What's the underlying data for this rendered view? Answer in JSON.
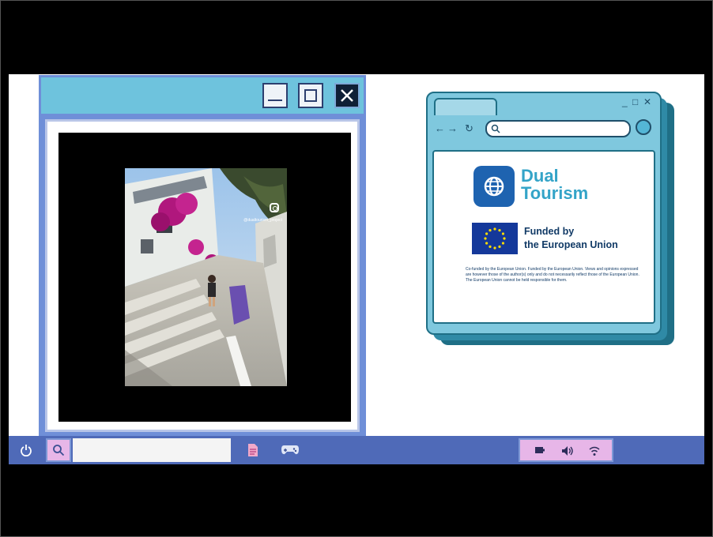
{
  "left_window": {
    "buttons": {
      "minimize": "minimize-button",
      "maximize": "maximize-button",
      "close": "close-button"
    },
    "photo": {
      "overlay_handle": "@dualtourism_project"
    }
  },
  "browser_window": {
    "controls": {
      "minimize": "_",
      "maximize": "□",
      "close": "✕"
    },
    "nav": {
      "back": "←",
      "forward": "→",
      "reload": "↻"
    },
    "address_bar": {
      "value": ""
    },
    "brand": {
      "line1": "Dual",
      "line2": "Tourism"
    },
    "eu": {
      "line1": "Funded by",
      "line2": "the European Union"
    },
    "disclaimer": "Co-funded by the European Union. Funded by the European Union. Views and opinions expressed are however those of the author(s) only and do not necessarily reflect those of the European Union. The European Union cannot be held responsible for them."
  },
  "taskbar": {
    "search": {
      "value": "",
      "placeholder": ""
    },
    "apps": [
      "document-icon",
      "gamepad-icon"
    ],
    "tray": [
      "battery-icon",
      "volume-icon",
      "wifi-icon"
    ]
  },
  "colors": {
    "window_blue": "#6f8fd8",
    "title_cyan": "#6ec3dd",
    "taskbar": "#4f6ab8",
    "tray_pink": "#e7b6e8",
    "brand_teal": "#34a4c8",
    "eu_blue": "#14389a"
  }
}
